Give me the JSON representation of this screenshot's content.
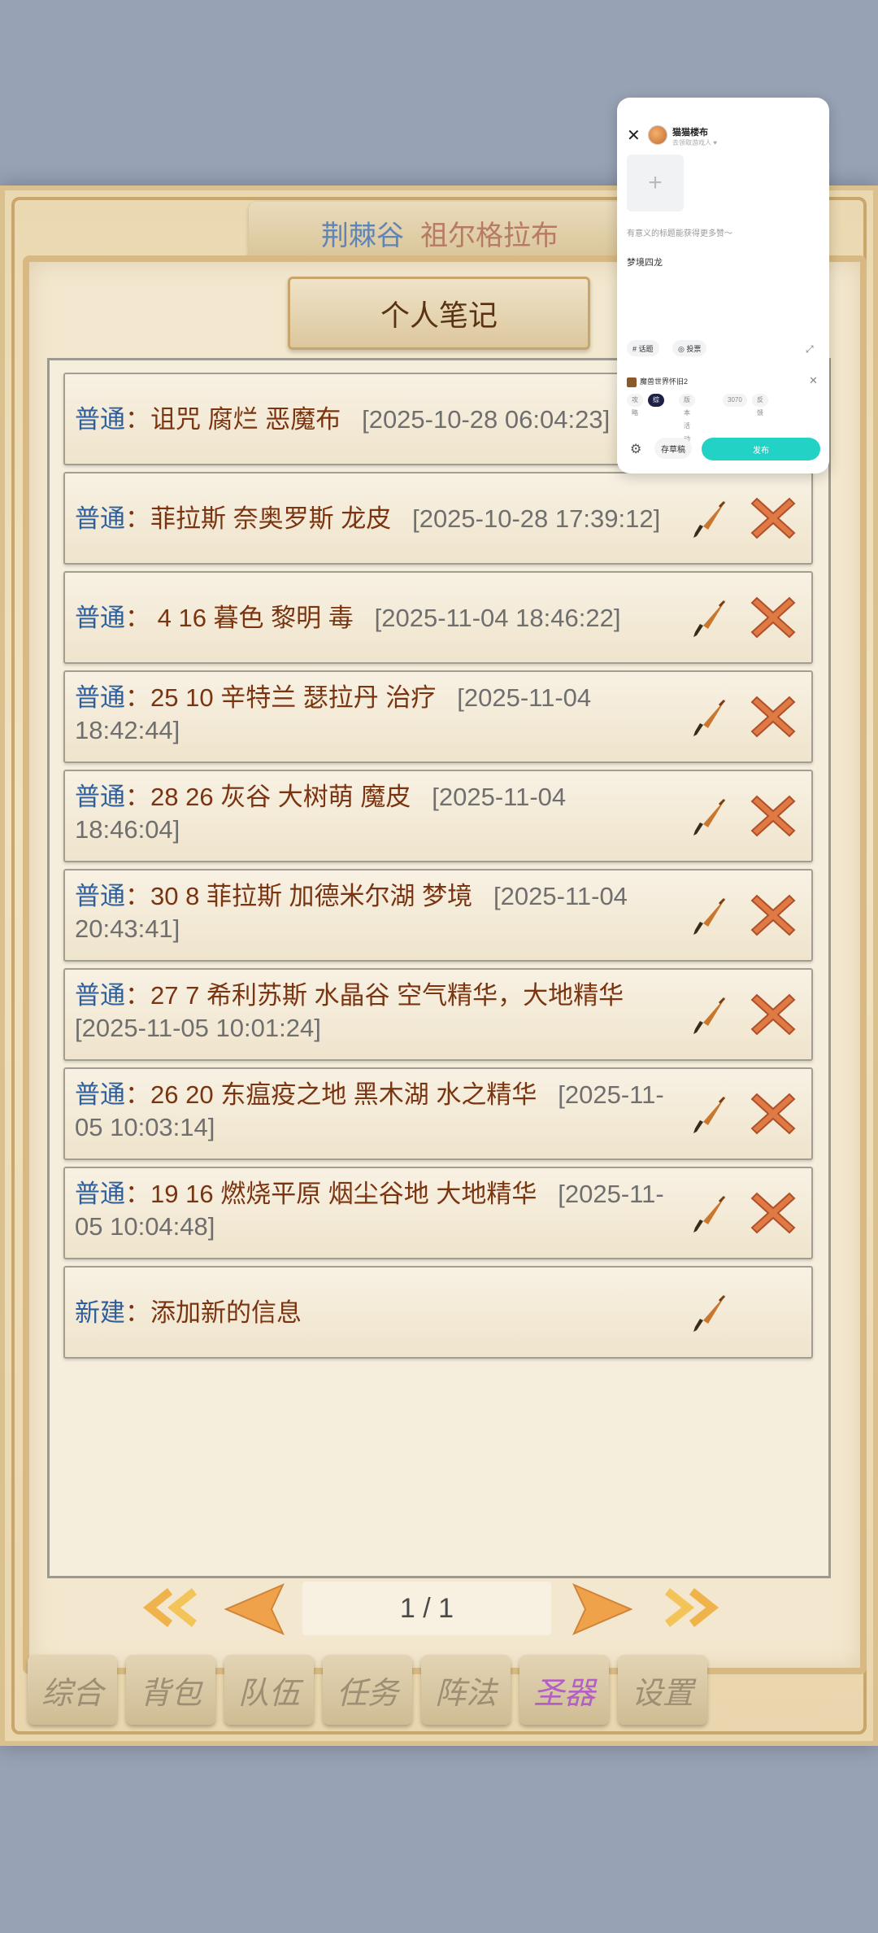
{
  "region": {
    "name_a": "荆棘谷",
    "name_b": "祖尔格拉布"
  },
  "panel_title": "个人笔记",
  "notes": [
    {
      "tag": "普通",
      "text": "诅咒 腐烂 恶魔布",
      "time": "2025-10-28 06:04:23"
    },
    {
      "tag": "普通",
      "text": "菲拉斯 奈奥罗斯 龙皮",
      "time": "2025-10-28 17:39:12"
    },
    {
      "tag": "普通",
      "text": " 4 16 暮色 黎明 毒",
      "time": "2025-11-04 18:46:22"
    },
    {
      "tag": "普通",
      "text": "25 10 辛特兰 瑟拉丹 治疗",
      "time": "2025-11-04 18:42:44"
    },
    {
      "tag": "普通",
      "text": "28 26 灰谷 大树萌 魔皮",
      "time": "2025-11-04 18:46:04"
    },
    {
      "tag": "普通",
      "text": "30  8 菲拉斯 加德米尔湖 梦境",
      "time": "2025-11-04 20:43:41"
    },
    {
      "tag": "普通",
      "text": "27  7 希利苏斯 水晶谷 空气精华，大地精华",
      "time": "2025-11-05 10:01:24"
    },
    {
      "tag": "普通",
      "text": "26 20 东瘟疫之地 黑木湖 水之精华",
      "time": "2025-11-05 10:03:14"
    },
    {
      "tag": "普通",
      "text": "19 16 燃烧平原 烟尘谷地 大地精华",
      "time": "2025-11-05 10:04:48"
    }
  ],
  "new_note": {
    "tag": "新建",
    "text": "添加新的信息"
  },
  "pager": {
    "indicator": "1 / 1"
  },
  "bottom_tabs": [
    "综合",
    "背包",
    "队伍",
    "任务",
    "阵法",
    "圣器",
    "设置"
  ],
  "active_tab": "圣器",
  "popup": {
    "user_name": "猫猫楼布",
    "user_sub": "去领取游戏人 ♥",
    "title_placeholder": "有意义的标题能获得更多赞～",
    "body_text": "梦境四龙",
    "chip_topic": "# 话题",
    "chip_vote": "◎ 投票",
    "game_name": "魔兽世界怀旧2",
    "categories": [
      "攻略",
      "综合",
      "版本活动",
      "3070",
      "反馈"
    ],
    "selected_category": "综合",
    "draft_label": "存草稿",
    "publish_label": "发布"
  },
  "colors": {
    "tag": "#2f5f9a",
    "note_text": "#7a3410",
    "time": "#6f6f6f",
    "publish": "#22d3c5",
    "active_tab": "#b35fc3"
  }
}
